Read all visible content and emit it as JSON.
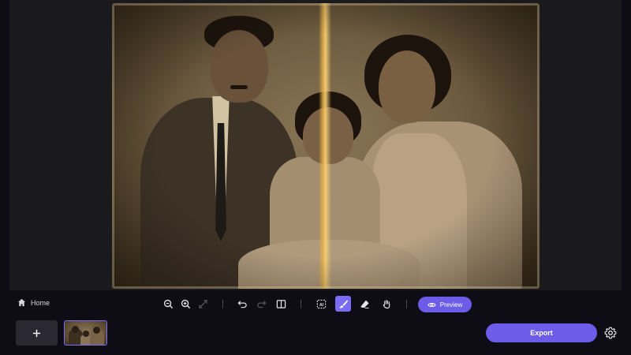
{
  "toolbar": {
    "home_label": "Home",
    "preview_label": "Preview",
    "tools": [
      {
        "icon": "zoom-out-icon"
      },
      {
        "icon": "zoom-in-icon"
      },
      {
        "icon": "fit-screen-icon",
        "state": "disabled"
      },
      {
        "icon": "undo-icon"
      },
      {
        "icon": "redo-icon",
        "state": "disabled"
      },
      {
        "icon": "compare-split-icon"
      },
      {
        "icon": "ai-select-icon"
      },
      {
        "icon": "brush-icon",
        "state": "active"
      },
      {
        "icon": "eraser-icon"
      },
      {
        "icon": "hand-pan-icon"
      }
    ]
  },
  "bottom": {
    "add_label": "+",
    "export_label": "Export"
  },
  "colors": {
    "accent": "#6c5ce7",
    "background": "#0e0c14",
    "canvas": "#1a1a1d"
  }
}
